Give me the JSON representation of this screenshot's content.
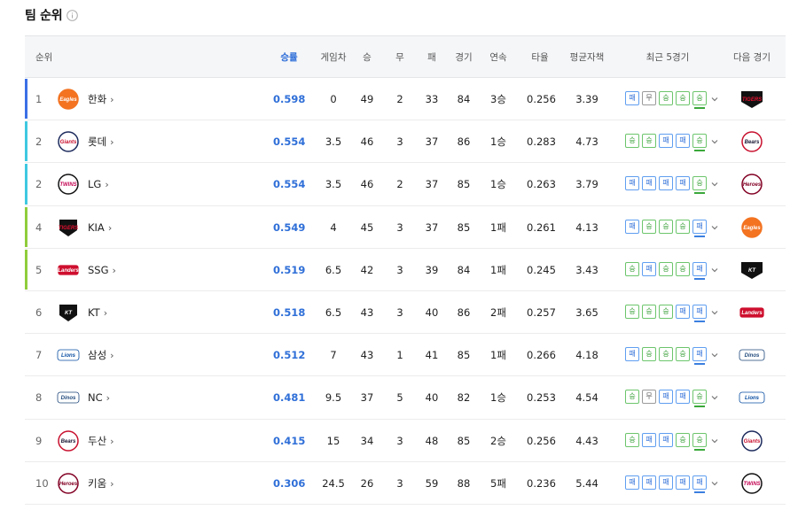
{
  "title": "팀 순위",
  "headers": {
    "rank": "순위",
    "win_rate": "승률",
    "games_behind": "게임차",
    "wins": "승",
    "draws": "무",
    "losses": "패",
    "games": "경기",
    "streak": "연속",
    "batting_avg": "타율",
    "era": "평균자책",
    "recent5": "최근 5경기",
    "next_game": "다음 경기"
  },
  "chevron": "›",
  "rows": [
    {
      "rank": "1",
      "team": "한화",
      "logo": "eagles-logo",
      "win_rate": "0.598",
      "gb": "0",
      "w": "49",
      "d": "2",
      "l": "33",
      "g": "84",
      "streak": "3승",
      "avg": "0.256",
      "era": "3.39",
      "recent": [
        "패",
        "무",
        "승",
        "승",
        "승"
      ],
      "next": "tigers-logo",
      "bar_color": "#3b6fe6"
    },
    {
      "rank": "2",
      "team": "롯데",
      "logo": "giants-logo",
      "win_rate": "0.554",
      "gb": "3.5",
      "w": "46",
      "d": "3",
      "l": "37",
      "g": "86",
      "streak": "1승",
      "avg": "0.283",
      "era": "4.73",
      "recent": [
        "승",
        "승",
        "패",
        "패",
        "승"
      ],
      "next": "bears-logo",
      "bar_color": "#3fc8e0"
    },
    {
      "rank": "2",
      "team": "LG",
      "logo": "twins-logo",
      "win_rate": "0.554",
      "gb": "3.5",
      "w": "46",
      "d": "2",
      "l": "37",
      "g": "85",
      "streak": "1승",
      "avg": "0.263",
      "era": "3.79",
      "recent": [
        "패",
        "패",
        "패",
        "패",
        "승"
      ],
      "next": "heroes-logo",
      "bar_color": "#3fc8e0"
    },
    {
      "rank": "4",
      "team": "KIA",
      "logo": "tigers-logo",
      "win_rate": "0.549",
      "gb": "4",
      "w": "45",
      "d": "3",
      "l": "37",
      "g": "85",
      "streak": "1패",
      "avg": "0.261",
      "era": "4.13",
      "recent": [
        "패",
        "승",
        "승",
        "승",
        "패"
      ],
      "next": "eagles-logo",
      "bar_color": "#8fcd3c"
    },
    {
      "rank": "5",
      "team": "SSG",
      "logo": "landers-logo",
      "win_rate": "0.519",
      "gb": "6.5",
      "w": "42",
      "d": "3",
      "l": "39",
      "g": "84",
      "streak": "1패",
      "avg": "0.245",
      "era": "3.43",
      "recent": [
        "승",
        "패",
        "승",
        "승",
        "패"
      ],
      "next": "wiz-logo",
      "bar_color": "#8fcd3c"
    },
    {
      "rank": "6",
      "team": "KT",
      "logo": "wiz-logo",
      "win_rate": "0.518",
      "gb": "6.5",
      "w": "43",
      "d": "3",
      "l": "40",
      "g": "86",
      "streak": "2패",
      "avg": "0.257",
      "era": "3.65",
      "recent": [
        "승",
        "승",
        "승",
        "패",
        "패"
      ],
      "next": "landers-logo",
      "bar_color": ""
    },
    {
      "rank": "7",
      "team": "삼성",
      "logo": "lions-logo",
      "win_rate": "0.512",
      "gb": "7",
      "w": "43",
      "d": "1",
      "l": "41",
      "g": "85",
      "streak": "1패",
      "avg": "0.266",
      "era": "4.18",
      "recent": [
        "패",
        "승",
        "승",
        "승",
        "패"
      ],
      "next": "dinos-logo",
      "bar_color": ""
    },
    {
      "rank": "8",
      "team": "NC",
      "logo": "dinos-logo",
      "win_rate": "0.481",
      "gb": "9.5",
      "w": "37",
      "d": "5",
      "l": "40",
      "g": "82",
      "streak": "1승",
      "avg": "0.253",
      "era": "4.54",
      "recent": [
        "승",
        "무",
        "패",
        "패",
        "승"
      ],
      "next": "lions-logo",
      "bar_color": ""
    },
    {
      "rank": "9",
      "team": "두산",
      "logo": "bears-logo",
      "win_rate": "0.415",
      "gb": "15",
      "w": "34",
      "d": "3",
      "l": "48",
      "g": "85",
      "streak": "2승",
      "avg": "0.256",
      "era": "4.43",
      "recent": [
        "승",
        "패",
        "패",
        "승",
        "승"
      ],
      "next": "giants-logo",
      "bar_color": ""
    },
    {
      "rank": "10",
      "team": "키움",
      "logo": "heroes-logo",
      "win_rate": "0.306",
      "gb": "24.5",
      "w": "26",
      "d": "3",
      "l": "59",
      "g": "88",
      "streak": "5패",
      "avg": "0.236",
      "era": "5.44",
      "recent": [
        "패",
        "패",
        "패",
        "패",
        "패"
      ],
      "next": "twins-logo",
      "bar_color": ""
    }
  ],
  "colors": {
    "accent": "#2f6fd8",
    "win": "#2e9a2e",
    "loss": "#2f6fd8",
    "draw": "#555555"
  }
}
